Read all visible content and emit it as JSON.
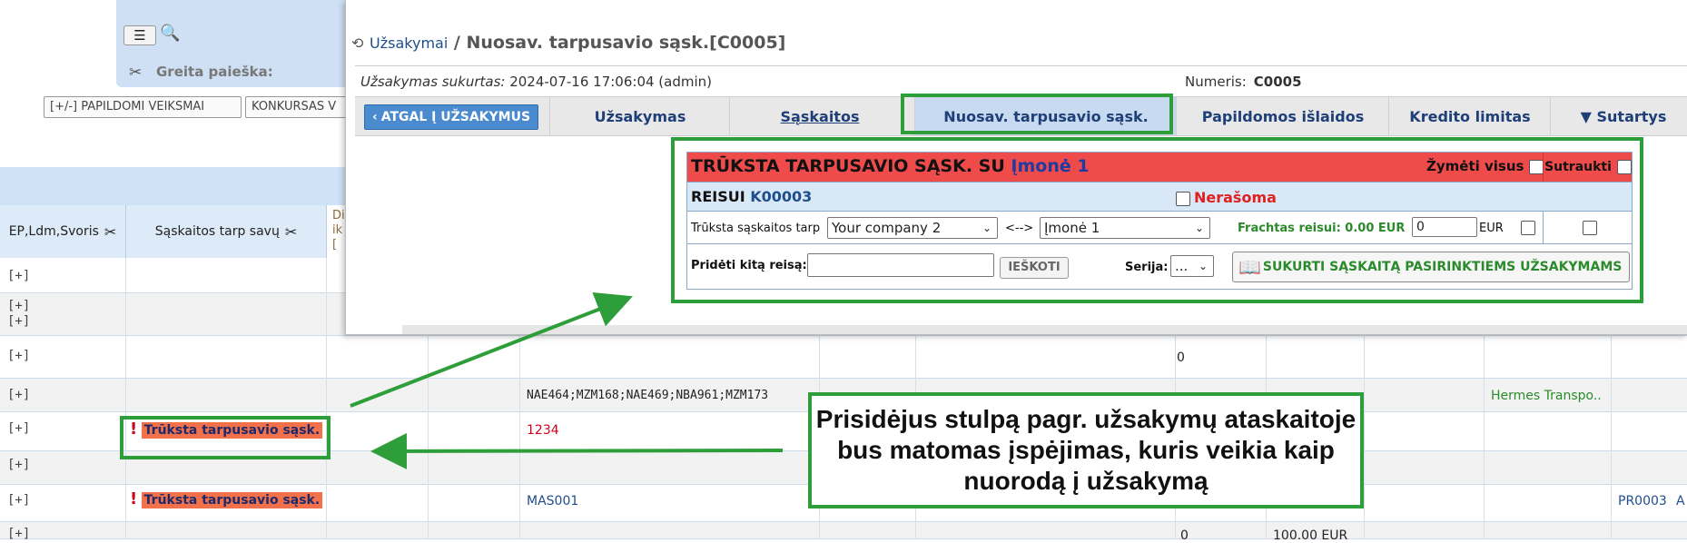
{
  "background": {
    "quick_search_label": "Greita paieška:",
    "buttons": [
      {
        "label": "[+/-] PAPILDOMI VEIKSMAI"
      },
      {
        "label": "KONKURSAS V"
      }
    ],
    "columns": [
      {
        "label": "EP,Ldm,Svoris"
      },
      {
        "label": "Sąskaitos tarp savų"
      }
    ],
    "truncated_header": [
      "Di",
      "ik",
      "["
    ],
    "rows": [
      {
        "plus": "[+]",
        "text": "",
        "warning": "",
        "extra": []
      },
      {
        "plus": "[+]\n[+]",
        "text": "",
        "warning": "",
        "extra": []
      },
      {
        "plus": "[+]",
        "text": "",
        "warning": "",
        "extra": [
          {
            "text": "0"
          }
        ]
      },
      {
        "plus": "[+]",
        "text": "NAE464;MZM168;NAE469;NBA961;MZM173",
        "warning": "",
        "extra": [
          {
            "text": "Hermes Transpo.."
          }
        ]
      },
      {
        "plus": "[+]",
        "text": "1234",
        "warning": "Trūksta tarpusavio sąsk.",
        "extra": []
      },
      {
        "plus": "[+]",
        "text": "",
        "warning": "",
        "extra": []
      },
      {
        "plus": "[+]",
        "text": "MAS001",
        "warning": "Trūksta tarpusavio sąsk.",
        "extra": [
          {
            "text": "PR0003"
          },
          {
            "text": "A"
          }
        ]
      },
      {
        "plus": "[+]",
        "text": "",
        "warning": "",
        "extra": [
          {
            "text": "0"
          },
          {
            "text": "100.00 EUR"
          }
        ]
      }
    ]
  },
  "modal": {
    "breadcrumb_link": "Užsakymai",
    "breadcrumb_sep": "/",
    "title": "Nuosav. tarpusavio sąsk.[C0005]",
    "created_label": "Užsakymas sukurtas:",
    "created_value": "2024-07-16 17:06:04 (admin)",
    "number_label": "Numeris:",
    "number_value": "C0005",
    "back_button": "ATGAL Į UŽSAKYMUS",
    "tabs": [
      {
        "label": "Užsakymas"
      },
      {
        "label": "Sąskaitos"
      },
      {
        "label": "Nuosav. tarpusavio sąsk."
      },
      {
        "label": "Papildomos išlaidos"
      },
      {
        "label": "Kredito limitas"
      },
      {
        "label": "▼ Sutartys"
      }
    ],
    "panel": {
      "title_prefix": "TRŪKSTA TARPUSAVIO SĄSK. SU",
      "title_company": "Įmonė 1",
      "mark_all": "Žymėti visus",
      "collapse": "Sutraukti",
      "trip_label": "REISUI",
      "trip_number": "K00003",
      "not_written": "Nerašoma",
      "missing_between_label": "Trūksta sąskaitos tarp",
      "company_from": "Your company 2",
      "arrow": "<-->",
      "company_to": "Įmonė 1",
      "freight": "Frachtas reisui: 0.00 EUR",
      "amount_value": "0",
      "currency": "EUR",
      "add_trip_label": "Pridėti kitą reisą:",
      "add_trip_value": "",
      "search_button": "IEŠKOTI",
      "series_label": "Serija:",
      "series_value": "...",
      "create_button": "SUKURTI SĄSKAITĄ PASIRINKTIEMS UŽSAKYMAMS"
    }
  },
  "annotation": {
    "text": "Prisidėjus stulpą pagr. užsakymų ataskaitoje bus matomas įspėjimas, kuris veikia kaip nuorodą į užsakymą"
  },
  "colors": {
    "highlight_green": "#2e9e3a",
    "panel_red": "#ef4b4b",
    "warning_badge": "#f2704a",
    "link_blue": "#1f4e8c"
  }
}
